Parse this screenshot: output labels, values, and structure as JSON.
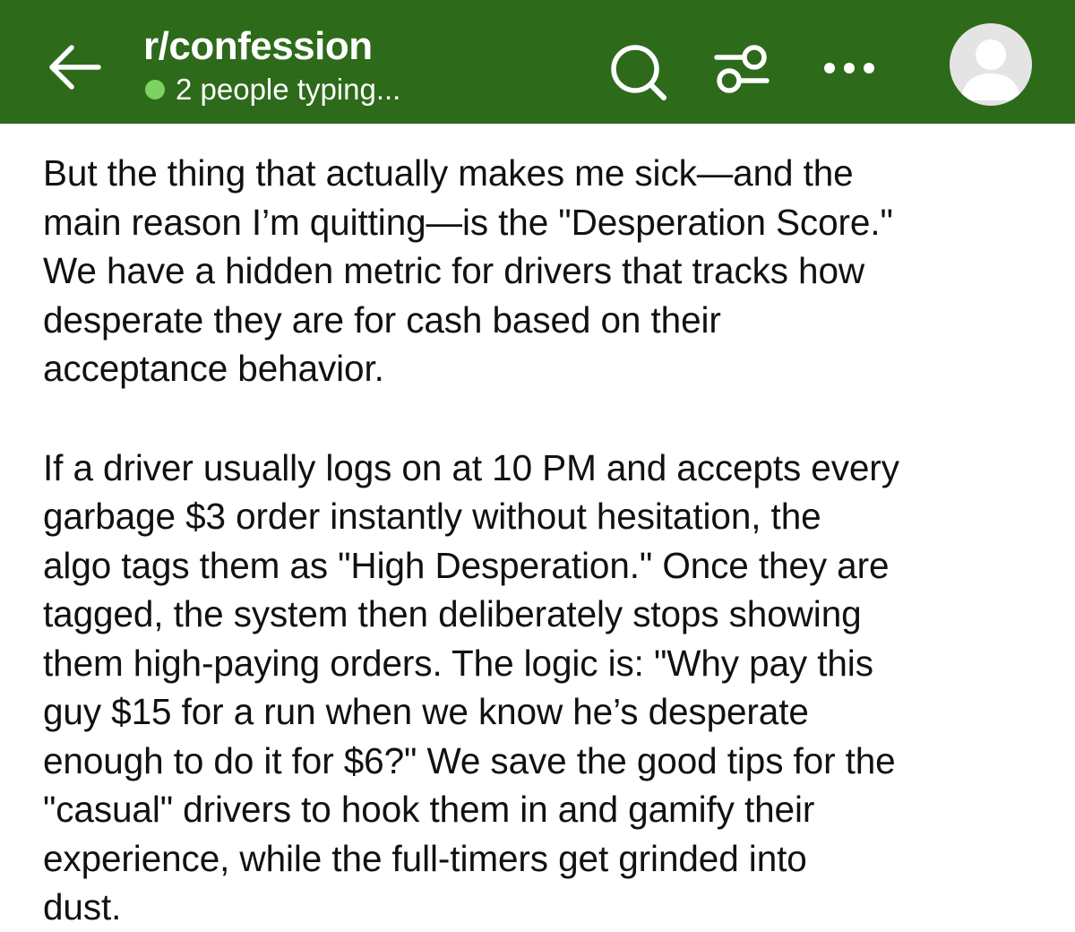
{
  "header": {
    "subreddit": "r/confession",
    "status_text": "2 people typing...",
    "colors": {
      "background": "#2d6a1a",
      "status_dot": "#7cd35f",
      "text": "#ffffff"
    },
    "icons": {
      "back": "arrow-left-icon",
      "search": "search-icon",
      "filter": "sliders-icon",
      "more": "more-horizontal-icon",
      "avatar": "user-avatar-icon"
    }
  },
  "post": {
    "paragraphs": [
      "But the thing that actually makes me sick—and the\nmain reason I’m quitting—is the \"Desperation Score.\"\nWe have a hidden metric for drivers that tracks how\ndesperate they are for cash based on their\nacceptance behavior.",
      "If a driver usually logs on at 10 PM and accepts every\ngarbage $3 order instantly without hesitation, the\nalgo tags them as \"High Desperation.\" Once they are\ntagged, the system then deliberately stops showing\nthem high-paying orders. The logic is: \"Why pay this\nguy $15 for a run when we know he’s desperate\nenough to do it for $6?\" We save the good tips for the\n\"casual\" drivers to hook them in and gamify their\nexperience, while the full-timers get grinded into\ndust."
    ]
  }
}
